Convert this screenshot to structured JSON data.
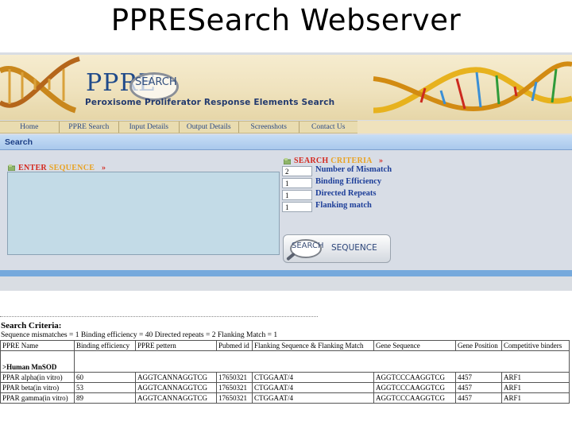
{
  "slide": {
    "title": "PPRESearch Webserver"
  },
  "banner": {
    "logo_main": "PPRE",
    "logo_search": "SEARCH",
    "tagline": "Peroxisome Proliferator Response Elements Search"
  },
  "nav": {
    "items": [
      "Home",
      "PPRE Search",
      "Input Details",
      "Output Details",
      "Screenshots",
      "Contact Us"
    ]
  },
  "search_panel": {
    "header": "Search",
    "enter_label_red": "ENTER",
    "enter_label_yellow": "SEQUENCE",
    "criteria_label_red": "SEARCH",
    "criteria_label_yellow": "CRITERIA",
    "arrow": "»",
    "params": [
      {
        "value": "2",
        "label": "Number of Mismatch"
      },
      {
        "value": "1",
        "label": "Binding Efficiency"
      },
      {
        "value": "1",
        "label": "Directed Repeats"
      },
      {
        "value": "1",
        "label": "Flanking match"
      }
    ],
    "button_logo": "SEARCH",
    "button_text": "SEQUENCE"
  },
  "results": {
    "criteria_title": "Search Criteria:",
    "criteria_line": "Sequence mismatches = 1 Binding efficiency = 40 Directed repeats = 2 Flanking Match = 1",
    "headers": [
      "PPRE Name",
      "Binding efficiency",
      "PPRE pettern",
      "Pubmed id",
      "Flanking Sequence & Flanking Match",
      "Gene Sequence",
      "Gene Position",
      "Competitive binders"
    ],
    "group": ">Human MnSOD",
    "rows": [
      [
        "PPAR alpha(in vitro)",
        "60",
        "AGGTCANNAGGTCG",
        "17650321",
        "CTGGAAT/4",
        "AGGTCCCAAGGTCG",
        "4457",
        "ARF1"
      ],
      [
        "PPAR beta(in vitro)",
        "53",
        "AGGTCANNAGGTCG",
        "17650321",
        "CTGGAAT/4",
        "AGGTCCCAAGGTCG",
        "4457",
        "ARF1"
      ],
      [
        "PPAR gamma(in vitro)",
        "89",
        "AGGTCANNAGGTCG",
        "17650321",
        "CTGGAAT/4",
        "AGGTCCCAAGGTCG",
        "4457",
        "ARF1"
      ]
    ]
  }
}
